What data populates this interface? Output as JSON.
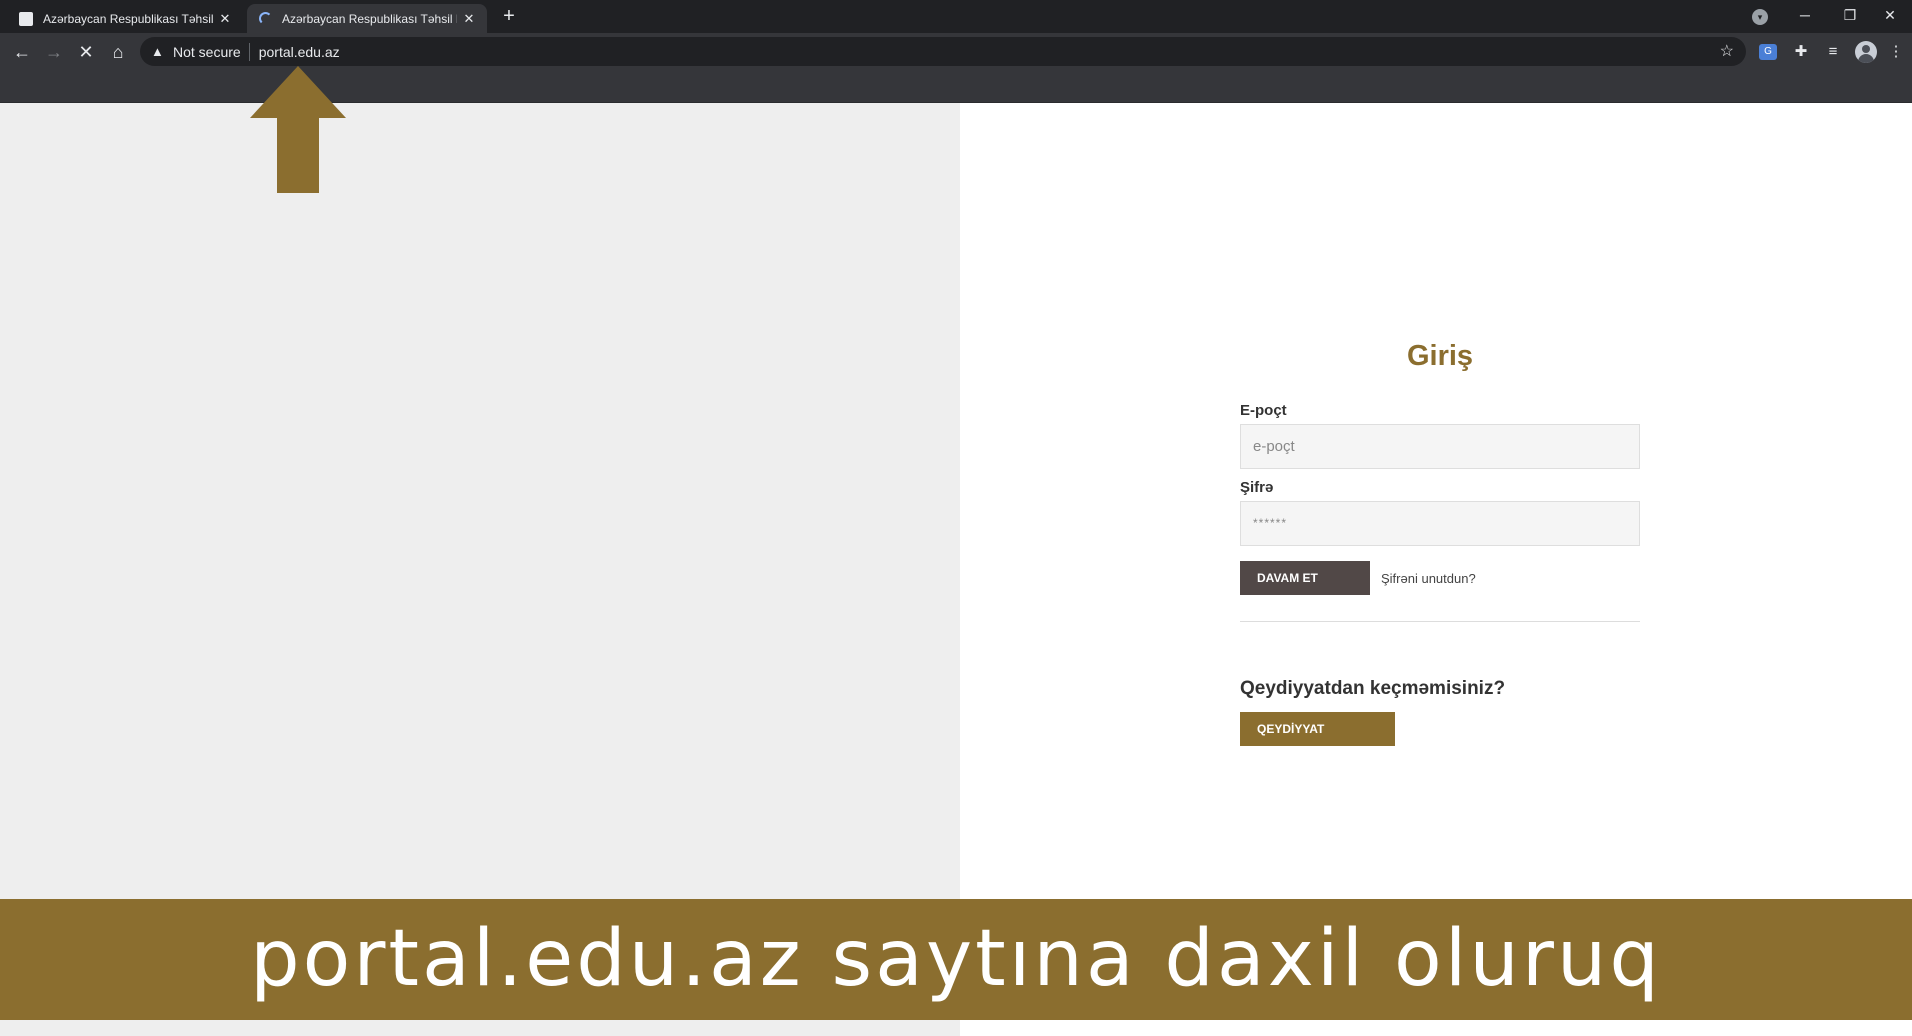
{
  "browser": {
    "tabs": [
      {
        "title": "Azərbaycan Respublikası Təhsil Nazirliyi",
        "state": "inactive"
      },
      {
        "title": "Azərbaycan Respublikası Təhsil Nazirliyi",
        "state": "loading"
      }
    ],
    "new_tab_symbol": "+",
    "window_controls": {
      "minimize": "─",
      "restore": "❐",
      "close": "✕"
    },
    "address_bar": {
      "security_label": "Not secure",
      "url": "portal.edu.az"
    }
  },
  "login": {
    "title": "Giriş",
    "email_label": "E-poçt",
    "email_placeholder": "e-poçt",
    "password_label": "Şifrə",
    "password_placeholder": "******",
    "submit_label": "DAVAM ET",
    "forgot_label": "Şifrəni unutdun?",
    "register_question": "Qeydiyyatdan keçməmisiniz?",
    "register_label": "QEYDİYYAT"
  },
  "caption": {
    "text": "portal.edu.az saytına daxil oluruq"
  },
  "colors": {
    "accent_gold": "#8b6e2f",
    "dark_button": "#514847",
    "left_panel": "#eeeeee"
  }
}
